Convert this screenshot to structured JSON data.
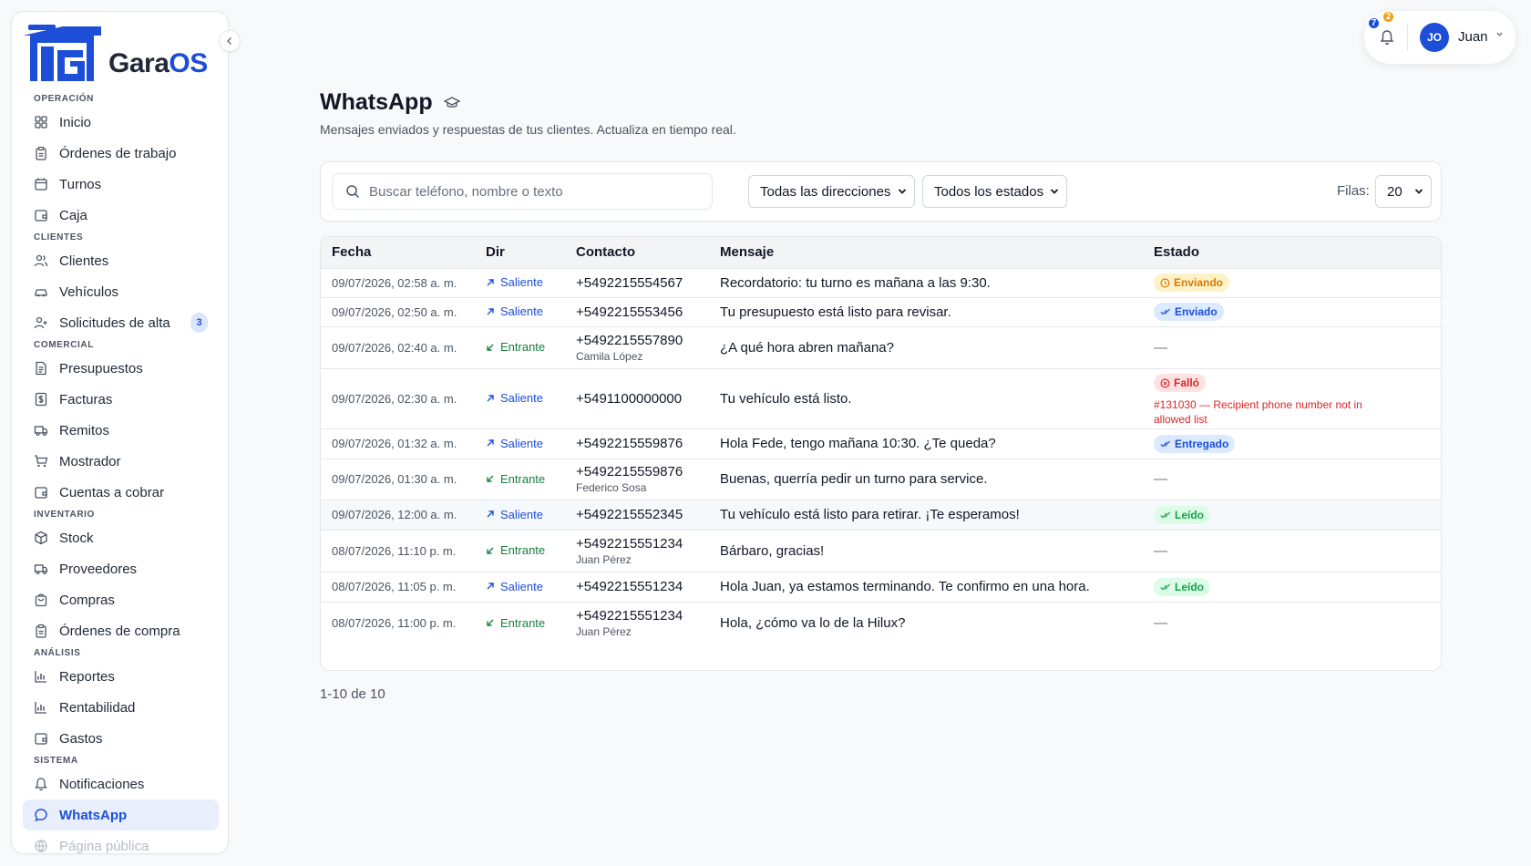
{
  "brand": {
    "name": "GaraOS"
  },
  "sidebar": {
    "sections": [
      {
        "label": "OPERACIÓN",
        "items": [
          {
            "label": "Inicio",
            "icon": "grid-icon"
          },
          {
            "label": "Órdenes de trabajo",
            "icon": "clipboard-icon"
          },
          {
            "label": "Turnos",
            "icon": "calendar-icon"
          },
          {
            "label": "Caja",
            "icon": "wallet-icon"
          }
        ]
      },
      {
        "label": "CLIENTES",
        "items": [
          {
            "label": "Clientes",
            "icon": "users-icon"
          },
          {
            "label": "Vehículos",
            "icon": "car-icon"
          },
          {
            "label": "Solicitudes de alta",
            "icon": "user-plus-icon",
            "badge": "3"
          }
        ]
      },
      {
        "label": "COMERCIAL",
        "items": [
          {
            "label": "Presupuestos",
            "icon": "file-text-icon"
          },
          {
            "label": "Facturas",
            "icon": "dollar-file-icon"
          },
          {
            "label": "Remitos",
            "icon": "truck-icon"
          },
          {
            "label": "Mostrador",
            "icon": "cart-icon"
          },
          {
            "label": "Cuentas a cobrar",
            "icon": "wallet-icon"
          }
        ]
      },
      {
        "label": "INVENTARIO",
        "items": [
          {
            "label": "Stock",
            "icon": "box-icon"
          },
          {
            "label": "Proveedores",
            "icon": "truck-icon"
          },
          {
            "label": "Compras",
            "icon": "bag-icon"
          },
          {
            "label": "Órdenes de compra",
            "icon": "clipboard-icon"
          }
        ]
      },
      {
        "label": "ANÁLISIS",
        "items": [
          {
            "label": "Reportes",
            "icon": "bar-chart-icon"
          },
          {
            "label": "Rentabilidad",
            "icon": "bar-chart-icon"
          },
          {
            "label": "Gastos",
            "icon": "wallet-icon"
          }
        ]
      },
      {
        "label": "SISTEMA",
        "items": [
          {
            "label": "Notificaciones",
            "icon": "bell-icon"
          },
          {
            "label": "WhatsApp",
            "icon": "chat-icon",
            "active": true
          },
          {
            "label": "Página pública",
            "icon": "globe-icon",
            "faded": true
          }
        ]
      }
    ]
  },
  "user": {
    "initials": "JO",
    "name": "Juan",
    "notif_blue": "7",
    "notif_orange": "2"
  },
  "page": {
    "title": "WhatsApp",
    "subtitle": "Mensajes enviados y respuestas de tus clientes. Actualiza en tiempo real."
  },
  "filters": {
    "search_placeholder": "Buscar teléfono, nombre o texto",
    "direction": "Todas las direcciones",
    "status": "Todos los estados",
    "rows_label": "Filas:",
    "rows_value": "20"
  },
  "table": {
    "headers": [
      "Fecha",
      "Dir",
      "Contacto",
      "Mensaje",
      "Estado"
    ],
    "rows": [
      {
        "fecha": "09/07/2026, 02:58 a. m.",
        "dir": "Saliente",
        "dir_type": "out",
        "phone": "+5492215554567",
        "name": "",
        "msg": "Recordatorio: tu turno es mañana a las 9:30.",
        "status": "Enviando",
        "status_type": "enviando"
      },
      {
        "fecha": "09/07/2026, 02:50 a. m.",
        "dir": "Saliente",
        "dir_type": "out",
        "phone": "+5492215553456",
        "name": "",
        "msg": "Tu presupuesto está listo para revisar.",
        "status": "Enviado",
        "status_type": "enviado"
      },
      {
        "fecha": "09/07/2026, 02:40 a. m.",
        "dir": "Entrante",
        "dir_type": "in",
        "phone": "+5492215557890",
        "name": "Camila López",
        "msg": "¿A qué hora abren mañana?",
        "status": "—",
        "status_type": "none"
      },
      {
        "fecha": "09/07/2026, 02:30 a. m.",
        "dir": "Saliente",
        "dir_type": "out",
        "phone": "+5491100000000",
        "name": "",
        "msg": "Tu vehículo está listo.",
        "status": "Falló",
        "status_type": "fallo",
        "error": "#131030 — Recipient phone number not in allowed list"
      },
      {
        "fecha": "09/07/2026, 01:32 a. m.",
        "dir": "Saliente",
        "dir_type": "out",
        "phone": "+5492215559876",
        "name": "",
        "msg": "Hola Fede, tengo mañana 10:30. ¿Te queda?",
        "status": "Entregado",
        "status_type": "entregado"
      },
      {
        "fecha": "09/07/2026, 01:30 a. m.",
        "dir": "Entrante",
        "dir_type": "in",
        "phone": "+5492215559876",
        "name": "Federico Sosa",
        "msg": "Buenas, querría pedir un turno para service.",
        "status": "—",
        "status_type": "none"
      },
      {
        "fecha": "09/07/2026, 12:00 a. m.",
        "dir": "Saliente",
        "dir_type": "out",
        "phone": "+5492215552345",
        "name": "",
        "msg": "Tu vehículo está listo para retirar. ¡Te esperamos!",
        "status": "Leído",
        "status_type": "leido",
        "highlight": true
      },
      {
        "fecha": "08/07/2026, 11:10 p. m.",
        "dir": "Entrante",
        "dir_type": "in",
        "phone": "+5492215551234",
        "name": "Juan Pérez",
        "msg": "Bárbaro, gracias!",
        "status": "—",
        "status_type": "none"
      },
      {
        "fecha": "08/07/2026, 11:05 p. m.",
        "dir": "Saliente",
        "dir_type": "out",
        "phone": "+5492215551234",
        "name": "",
        "msg": "Hola Juan, ya estamos terminando. Te confirmo en una hora.",
        "status": "Leído",
        "status_type": "leido"
      },
      {
        "fecha": "08/07/2026, 11:00 p. m.",
        "dir": "Entrante",
        "dir_type": "in",
        "phone": "+5492215551234",
        "name": "Juan Pérez",
        "msg": "Hola, ¿cómo va lo de la Hilux?",
        "status": "—",
        "status_type": "none"
      }
    ]
  },
  "pagination": {
    "text": "1-10 de 10"
  },
  "colors": {
    "accent": "#1d4ed8",
    "incoming": "#15803d",
    "warning": "#d97706",
    "error": "#dc2626",
    "success": "#16a34a"
  }
}
